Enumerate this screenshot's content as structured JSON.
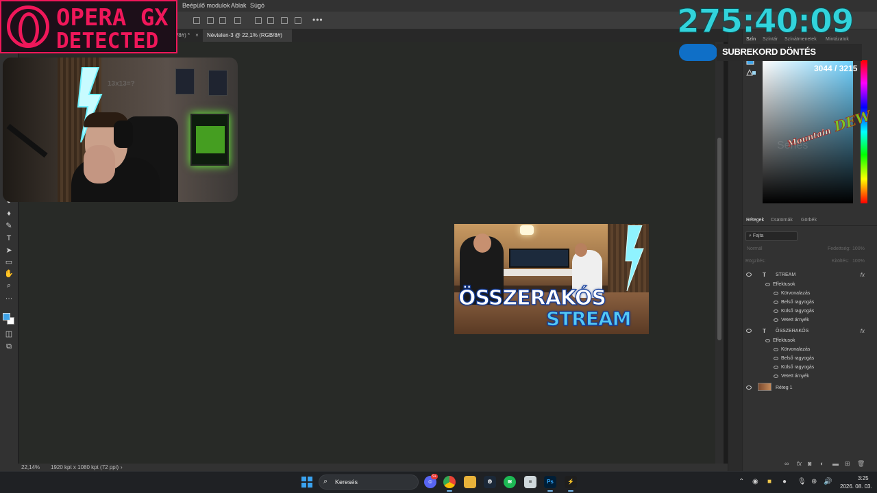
{
  "menubar": {
    "items": [
      "Beépülő modulok",
      "Ablak",
      "Súgó"
    ]
  },
  "tabs": [
    {
      "label": "/8#) *",
      "active": false
    },
    {
      "label": "Névtelen-3 @ 22,1% (RGB/8#) *",
      "active": true
    }
  ],
  "statusbar": {
    "zoom": "22,14%",
    "docsize": "1920 kpt x 1080 kpt (72 ppi)"
  },
  "overlay": {
    "opera_line1": "OPERA GX",
    "opera_line2": "DETECTED",
    "timer": "275:40:09",
    "sub_label": "SUBREKORD DÖNTÉS",
    "sub_count": "3044 / 3215",
    "webcam_text": "13x13=?"
  },
  "thumbnail": {
    "title_line1": "ÖSSZERAKÓS",
    "title_line2": "STREAM"
  },
  "color_panel": {
    "tabs": [
      "Szín",
      "Színtár",
      "Színátmenetek",
      "Mintázatok"
    ],
    "logo_small": "Mountain",
    "logo_big": "DEW",
    "watermark": "Series"
  },
  "layers_panel": {
    "tabs": [
      "Rétegek",
      "Csatornák",
      "Görbék"
    ],
    "search": "Fajta",
    "blend": "Normál",
    "opacity_label": "Fedettség:",
    "opacity_value": "100%",
    "lock_label": "Rögzítés:",
    "fill_label": "Kitöltés:",
    "fill_value": "100%",
    "fx_label": "fx",
    "layers": [
      {
        "name": "STREAM",
        "effects_label": "Effektusok",
        "effects": [
          "Körvonalazás",
          "Belső ragyogás",
          "Külső ragyogás",
          "Vetett árnyék"
        ]
      },
      {
        "name": "ÖSSZERAKÓS",
        "effects_label": "Effektusok",
        "effects": [
          "Körvonalazás",
          "Belső ragyogás",
          "Külső ragyogás",
          "Vetett árnyék"
        ]
      },
      {
        "name": "Réteg 1"
      }
    ]
  },
  "taskbar": {
    "search_placeholder": "Keresés",
    "badge": "9+",
    "ps_label": "Ps",
    "time": "3:25",
    "date": "2026. 08. 03."
  },
  "colors": {
    "accent_opera": "#f0175a",
    "timer": "#32d3db",
    "foreground_swatch": "#3ea3e8",
    "background_swatch": "#ffffff"
  }
}
